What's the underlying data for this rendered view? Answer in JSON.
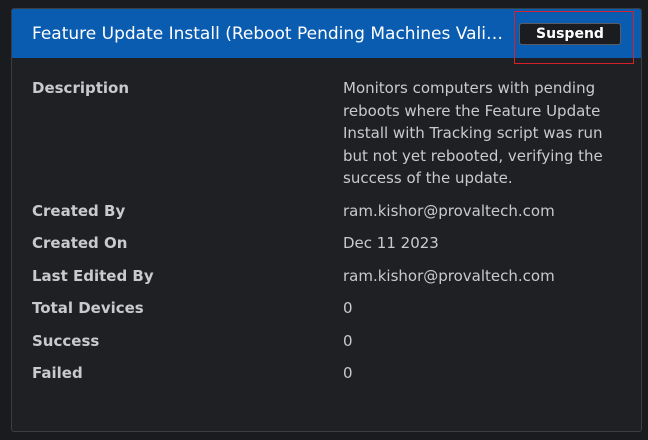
{
  "header": {
    "title": "Feature Update Install (Reboot Pending Machines Valida...",
    "suspend_label": "Suspend"
  },
  "details": [
    {
      "label": "Description",
      "value": "Monitors computers with pending reboots where the Feature Update Install with Tracking script was run but not yet rebooted, verifying the success of the update."
    },
    {
      "label": "Created By",
      "value": "ram.kishor@provaltech.com"
    },
    {
      "label": "Created On",
      "value": "Dec 11 2023"
    },
    {
      "label": "Last Edited By",
      "value": "ram.kishor@provaltech.com"
    },
    {
      "label": "Total Devices",
      "value": "0"
    },
    {
      "label": "Success",
      "value": "0"
    },
    {
      "label": "Failed",
      "value": "0"
    }
  ],
  "colors": {
    "header_bg": "#0a5cb0",
    "page_bg": "#1a1b1e",
    "card_bg": "#1f2023",
    "text": "#c8cacd",
    "highlight": "#d6202a"
  }
}
